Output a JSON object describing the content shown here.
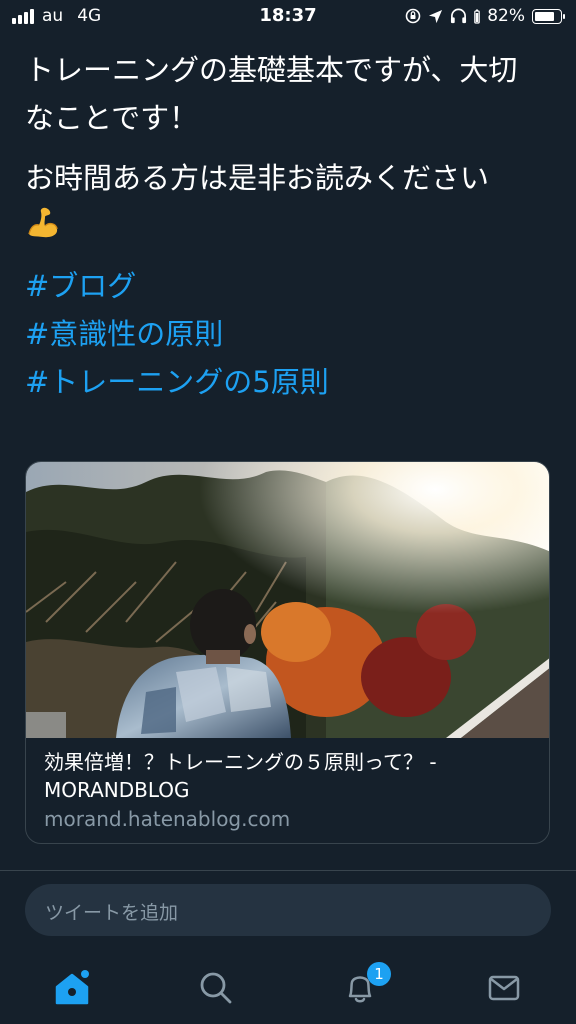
{
  "status_bar": {
    "carrier": "au",
    "network": "4G",
    "time": "18:37",
    "battery_percent": "82%",
    "battery_level": 0.82
  },
  "tweet": {
    "paragraph1": "トレーニングの基礎基本ですが、大切なことです！",
    "paragraph2": "お時間ある方は是非お読みください",
    "emoji": "flexed-biceps-icon",
    "hashtags": [
      "#ブログ",
      "#意識性の原則",
      "#トレーニングの5原則"
    ]
  },
  "link_card": {
    "title": "効果倍増！？トレーニングの５原則って？ - MORANDBLOG",
    "domain": "morand.hatenablog.com"
  },
  "reply": {
    "placeholder": "ツイートを追加"
  },
  "tab_bar": {
    "items": [
      "home-icon",
      "search-icon",
      "notifications-icon",
      "messages-icon"
    ],
    "notification_count": "1",
    "accent_color": "#1da1f2"
  }
}
